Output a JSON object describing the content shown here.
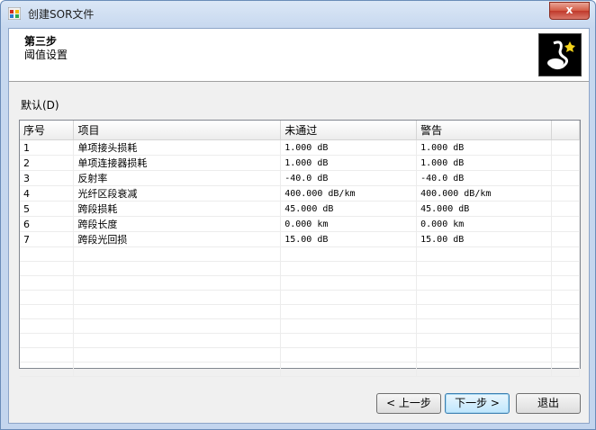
{
  "window": {
    "title": "创建SOR文件",
    "close_label": "x"
  },
  "header": {
    "step": "第三步",
    "subtitle": "阈值设置"
  },
  "section_label": "默认(D)",
  "columns": [
    "序号",
    "项目",
    "未通过",
    "警告"
  ],
  "rows": [
    [
      "1",
      "单项接头损耗",
      "1.000 dB",
      "1.000 dB"
    ],
    [
      "2",
      "单项连接器损耗",
      "1.000 dB",
      "1.000 dB"
    ],
    [
      "3",
      "反射率",
      "-40.0 dB",
      "-40.0 dB"
    ],
    [
      "4",
      "光纤区段衰减",
      "400.000 dB/km",
      "400.000 dB/km"
    ],
    [
      "5",
      "跨段损耗",
      "45.000 dB",
      "45.000 dB"
    ],
    [
      "6",
      "跨段长度",
      "0.000 km",
      "0.000 km"
    ],
    [
      "7",
      "跨段光回损",
      "15.00 dB",
      "15.00 dB"
    ]
  ],
  "buttons": {
    "prev": "< 上一步",
    "next": "下一步 >",
    "exit": "退出"
  }
}
